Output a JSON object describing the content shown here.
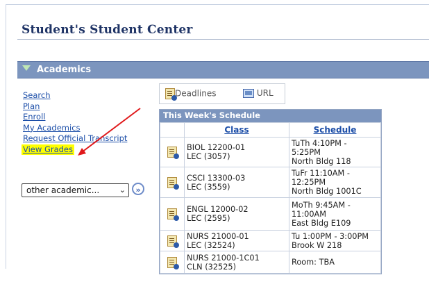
{
  "page": {
    "title": "Student's Student Center"
  },
  "section": {
    "title": "Academics"
  },
  "links": [
    {
      "label": "Search"
    },
    {
      "label": "Plan"
    },
    {
      "label": "Enroll"
    },
    {
      "label": "My Academics"
    },
    {
      "label": "Request Official Transcript"
    },
    {
      "label": "View Grades",
      "highlighted": true
    }
  ],
  "dropdown": {
    "selected": "other academic..."
  },
  "toolbar": {
    "deadlines_label": "Deadlines",
    "url_label": "URL"
  },
  "schedule": {
    "title": "This Week's Schedule",
    "columns": [
      "Class",
      "Schedule"
    ],
    "rows": [
      {
        "class_line1": "BIOL 12200-01",
        "class_line2": "LEC (3057)",
        "sched_line1": "TuTh 4:10PM -",
        "sched_line2": "5:25PM",
        "sched_line3": "North Bldg 118"
      },
      {
        "class_line1": "CSCI 13300-03",
        "class_line2": "LEC (3559)",
        "sched_line1": "TuFr 11:10AM -",
        "sched_line2": "12:25PM",
        "sched_line3": "North Bldg 1001C"
      },
      {
        "class_line1": "ENGL 12000-02",
        "class_line2": "LEC (2595)",
        "sched_line1": "MoTh 9:45AM -",
        "sched_line2": "11:00AM",
        "sched_line3": "East Bldg E109"
      },
      {
        "class_line1": "NURS 21000-01",
        "class_line2": "LEC (32524)",
        "sched_line1": "Tu 1:00PM - 3:00PM",
        "sched_line2": "Brook W 218",
        "sched_line3": ""
      },
      {
        "class_line1": "NURS 21000-1C01",
        "class_line2": "CLN (32525)",
        "sched_line1": "Room:  TBA",
        "sched_line2": "",
        "sched_line3": ""
      }
    ]
  },
  "colors": {
    "header_blue": "#7c95be",
    "link_blue": "#1c4ea8",
    "highlight": "#ffff00",
    "arrow": "#e0191b"
  }
}
